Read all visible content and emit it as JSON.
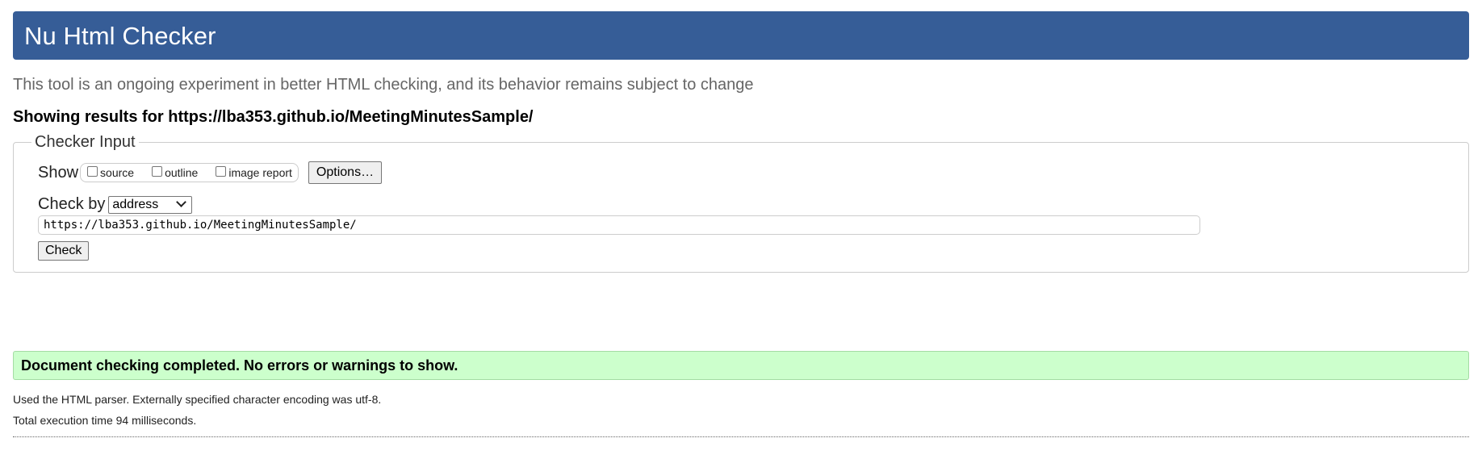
{
  "header": {
    "title": "Nu Html Checker"
  },
  "tagline": "This tool is an ongoing experiment in better HTML checking, and its behavior remains subject to change",
  "results_for": "Showing results for https://lba353.github.io/MeetingMinutesSample/",
  "checker_input": {
    "legend": "Checker Input",
    "show_label": "Show",
    "show_options": [
      {
        "label": "source",
        "checked": false
      },
      {
        "label": "outline",
        "checked": false
      },
      {
        "label": "image report",
        "checked": false
      }
    ],
    "options_button": "Options…",
    "check_by_label": "Check by",
    "check_by_selected": "address",
    "url_value": "https://lba353.github.io/MeetingMinutesSample/",
    "check_button": "Check"
  },
  "result": {
    "success_message": "Document checking completed. No errors or warnings to show.",
    "parser_info": "Used the HTML parser. Externally specified character encoding was utf-8.",
    "execution_time": "Total execution time 94 milliseconds."
  },
  "colors": {
    "header_bg": "#365d97",
    "success_bg": "#ccffcc"
  }
}
